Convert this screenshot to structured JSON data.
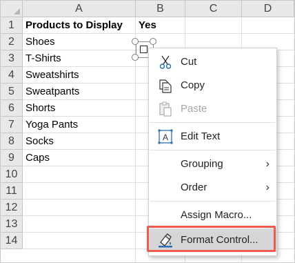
{
  "columns": [
    "A",
    "B",
    "C",
    "D"
  ],
  "rows": [
    "1",
    "2",
    "3",
    "4",
    "5",
    "6",
    "7",
    "8",
    "9",
    "10",
    "11",
    "12",
    "13",
    "14"
  ],
  "cells": {
    "a1": "Products to Display",
    "b1": "Yes",
    "a2": "Shoes",
    "a3": "T-Shirts",
    "a4": "Sweatshirts",
    "a5": "Sweatpants",
    "a6": "Shorts",
    "a7": "Yoga Pants",
    "a8": "Socks",
    "a9": "Caps"
  },
  "context_menu": {
    "items": [
      {
        "label": "Cut",
        "icon": "scissors-icon",
        "enabled": true
      },
      {
        "label": "Copy",
        "icon": "copy-icon",
        "enabled": true
      },
      {
        "label": "Paste",
        "icon": "paste-icon",
        "enabled": false
      },
      {
        "label": "Edit Text",
        "icon": "edit-text-icon",
        "enabled": true
      },
      {
        "label": "Grouping",
        "submenu": true,
        "enabled": true
      },
      {
        "label": "Order",
        "submenu": true,
        "enabled": true
      },
      {
        "label": "Assign Macro...",
        "enabled": true
      },
      {
        "label": "Format Control...",
        "icon": "format-control-icon",
        "enabled": true,
        "highlighted": true
      }
    ]
  },
  "colors": {
    "header_bg": "#e8e8e8",
    "highlight_border": "#ee5a4e",
    "selected_item_bg": "#d6d6d6",
    "icon_blue": "#2b6cb0"
  }
}
